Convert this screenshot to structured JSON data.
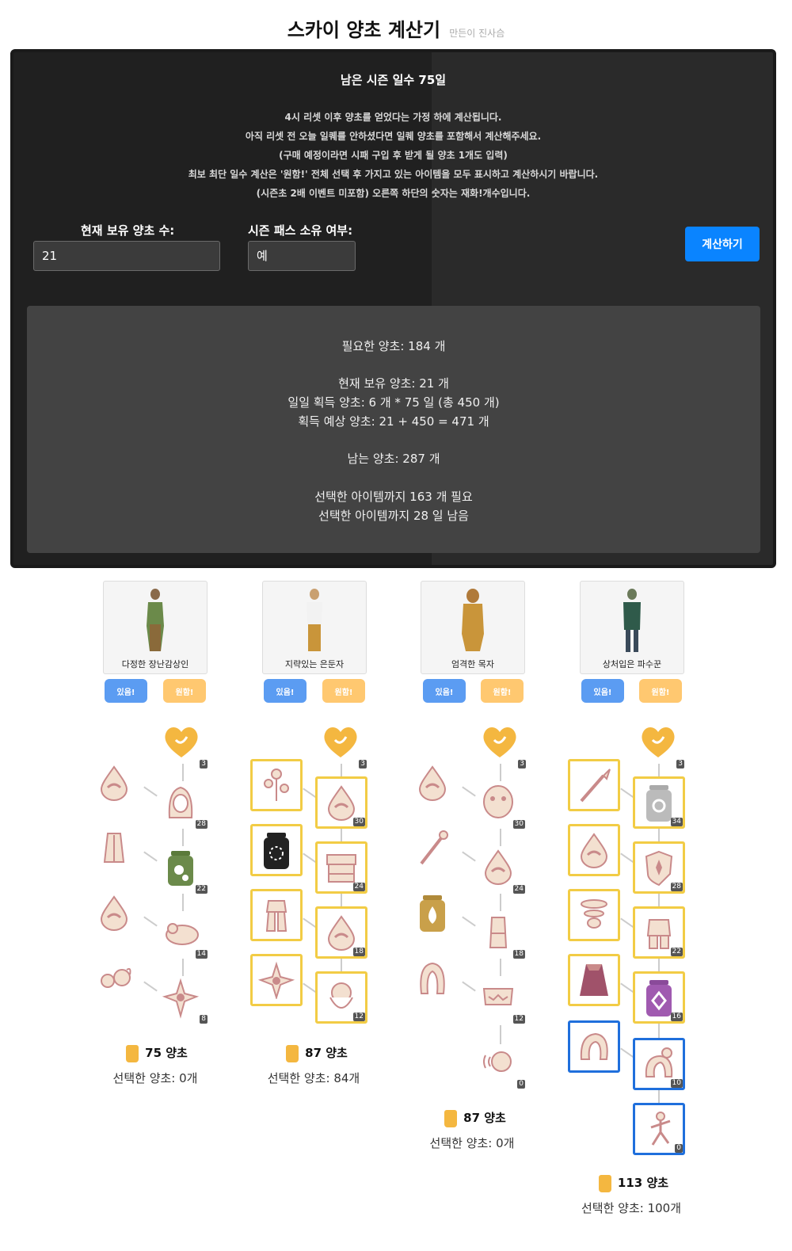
{
  "header": {
    "title": "스카이 양초 계산기",
    "author": "만든이 진사슴"
  },
  "panel": {
    "days_left": "남은 시즌 일수 75일",
    "notes": [
      "4시 리셋 이후 양초를 얻었다는 가정 하에 계산됩니다.",
      "아직 리셋 전 오늘 일퀘를 안하셨다면 일퀘 양초를 포함해서 계산해주세요.",
      "(구매 예정이라면 시패 구입 후 받게 될 양초 1개도 입력)",
      "최보 최단 일수 계산은 '원함!' 전체 선택 후 가지고 있는 아이템을 모두 표시하고 계산하시기 바랍니다.",
      "(시즌초 2배 이벤트 미포함) 오른쪽 하단의 숫자는 재화!개수입니다."
    ],
    "candles_label": "현재 보유 양초 수:",
    "candles_value": "21",
    "pass_label": "시즌 패스 소유 여부:",
    "pass_value": "예",
    "calc_button": "계산하기"
  },
  "result": {
    "needed": "필요한 양초: 184 개",
    "have": "현재 보유 양초: 21 개",
    "daily": "일일 획득 양초: 6 개 * 75 일 (총 450 개)",
    "expected": "획득 예상 양초: 21 + 450 = 471 개",
    "remaining": "남는 양초: 287 개",
    "selected_needed": "선택한 아이템까지 163 개 필요",
    "selected_days": "선택한 아이템까지 28 일 남음"
  },
  "spirits": [
    {
      "name": "다정한 장난감상인",
      "have": "있음!",
      "want": "원함!",
      "main_counts": [
        "3",
        "28",
        "22",
        "14",
        "8"
      ],
      "cost": "75 양초",
      "selected": "선택한 양초: 0개"
    },
    {
      "name": "지략있는 은둔자",
      "have": "있음!",
      "want": "원함!",
      "main_counts": [
        "3",
        "30",
        "24",
        "18",
        "12"
      ],
      "cost": "87 양초",
      "selected": "선택한 양초: 84개"
    },
    {
      "name": "엄격한 목자",
      "have": "있음!",
      "want": "원함!",
      "main_counts": [
        "3",
        "30",
        "24",
        "18",
        "12",
        "0"
      ],
      "cost": "87 양초",
      "selected": "선택한 양초: 0개"
    },
    {
      "name": "상처입은 파수꾼",
      "have": "있음!",
      "want": "원함!",
      "main_counts": [
        "3",
        "34",
        "28",
        "22",
        "16",
        "10",
        "0"
      ],
      "cost": "113 양초",
      "selected": "선택한 양초: 100개"
    }
  ],
  "colors": {
    "accent": "#0a84ff",
    "have_pill": "#5b9cf2",
    "want_pill": "#ffc870",
    "selected_border": "#f2cc45",
    "owned_border": "#1f6fdc",
    "heart": "#f4b740",
    "item": "#c98a8a"
  }
}
